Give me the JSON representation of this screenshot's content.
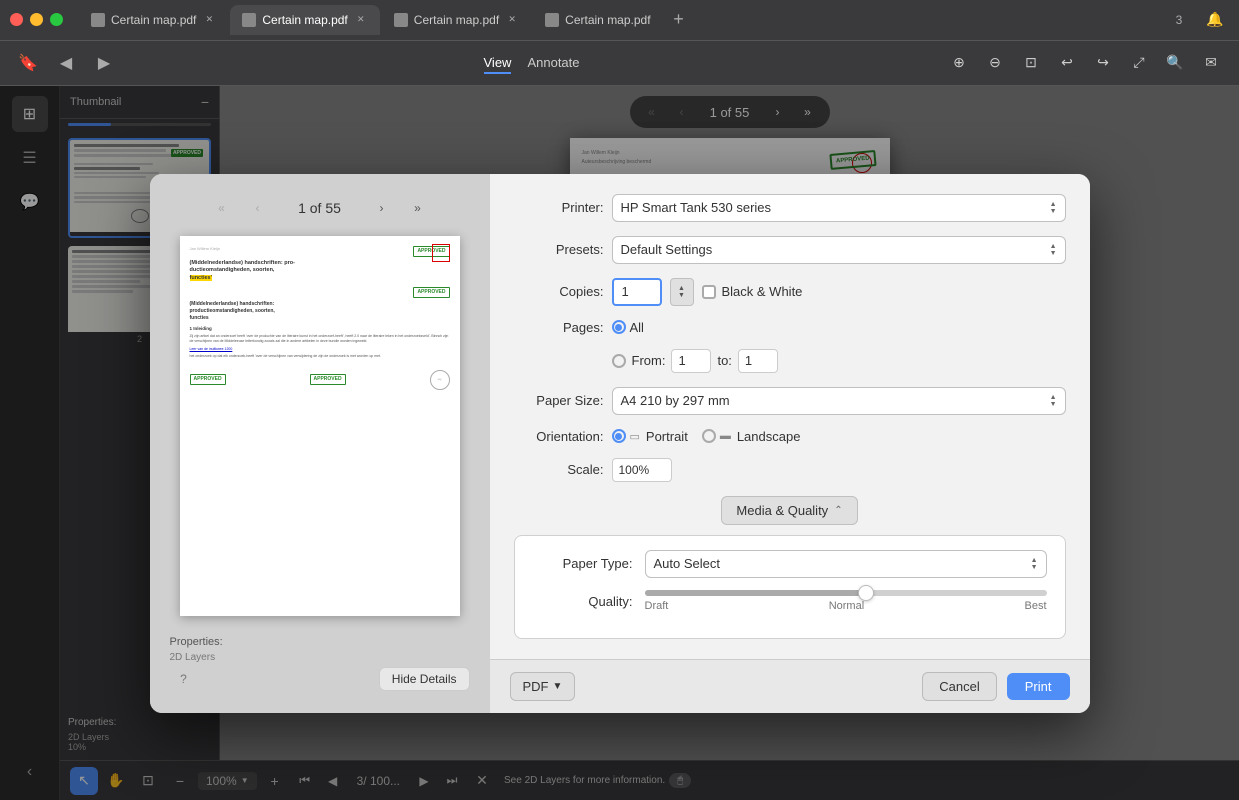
{
  "browser": {
    "tabs": [
      {
        "label": "Certain map.pdf",
        "active": false,
        "favicon": true
      },
      {
        "label": "Certain map.pdf",
        "active": true,
        "favicon": true
      },
      {
        "label": "Certain map.pdf",
        "active": false,
        "favicon": true
      },
      {
        "label": "Certain map.pdf",
        "active": false,
        "favicon": true
      }
    ],
    "nav": {
      "back": "‹",
      "forward": "›",
      "reload": "↺"
    },
    "toolbar": {
      "view_label": "View",
      "annotate_label": "Annotate"
    },
    "notification_count": "3"
  },
  "sidebar": {
    "items": [
      {
        "icon": "⊞",
        "label": "grid-icon"
      },
      {
        "icon": "☰",
        "label": "list-icon"
      },
      {
        "icon": "💬",
        "label": "comment-icon"
      }
    ]
  },
  "thumbnail_panel": {
    "title": "Thumbnail",
    "pages": [
      {
        "num": ""
      },
      {
        "num": "2"
      }
    ]
  },
  "page_navigation": {
    "current": "1 of 55",
    "prev_prev": "«",
    "prev": "‹",
    "next": "›",
    "next_next": "»"
  },
  "bottom_toolbar": {
    "zoom": "100%",
    "page_counter": "3/ 100...",
    "info_text": "See 2D Layers for more information."
  },
  "layers_text": "2D Layers",
  "layers_value": "10%",
  "print_dialog": {
    "printer_label": "Printer:",
    "printer_value": "HP Smart Tank 530 series",
    "presets_label": "Presets:",
    "presets_value": "Default Settings",
    "copies_label": "Copies:",
    "copies_value": "1",
    "bw_label": "Black & White",
    "pages_label": "Pages:",
    "pages_all_label": "All",
    "pages_from_label": "From:",
    "pages_from_value": "1",
    "pages_to_label": "to:",
    "pages_to_value": "1",
    "paper_size_label": "Paper Size:",
    "paper_size_value": "A4 210 by 297 mm",
    "orientation_label": "Orientation:",
    "portrait_label": "Portrait",
    "landscape_label": "Landscape",
    "scale_label": "Scale:",
    "scale_value": "100%",
    "media_quality_label": "Media & Quality",
    "paper_type_label": "Paper Type:",
    "paper_type_value": "Auto Select",
    "quality_label": "Quality:",
    "quality_draft": "Draft",
    "quality_normal": "Normal",
    "quality_best": "Best",
    "pdf_btn": "PDF",
    "cancel_btn": "Cancel",
    "print_btn": "Print",
    "hide_details_btn": "Hide Details",
    "help_btn": "?",
    "preview_counter": "1 of 55",
    "collapsible_arrow": "⌃"
  }
}
